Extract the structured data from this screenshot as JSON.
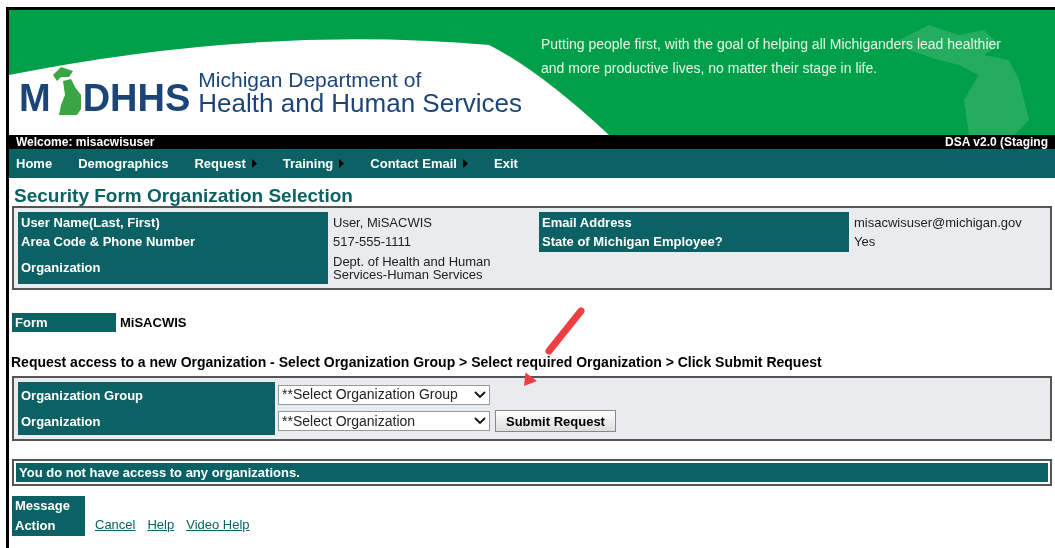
{
  "banner": {
    "logo_left": "M",
    "logo_right": "DHHS",
    "department_line1": "Michigan Department of",
    "department_line2": "Health and Human Services",
    "tagline": "Putting people first, with the goal of helping all Michiganders lead healthier and more productive lives, no matter their stage in life."
  },
  "welcome_bar": {
    "welcome": "Welcome: misacwisuser",
    "version": "DSA v2.0 (Staging"
  },
  "nav": [
    {
      "label": "Home",
      "has_submenu": false
    },
    {
      "label": "Demographics",
      "has_submenu": false
    },
    {
      "label": "Request",
      "has_submenu": true
    },
    {
      "label": "Training",
      "has_submenu": true
    },
    {
      "label": "Contact Email",
      "has_submenu": true
    },
    {
      "label": "Exit",
      "has_submenu": false
    }
  ],
  "page_title": "Security Form Organization Selection",
  "user_info": {
    "left": [
      {
        "label": "User Name(Last, First)",
        "value": "User, MiSACWIS"
      },
      {
        "label": "Area Code & Phone Number",
        "value": "517-555-1111"
      },
      {
        "label": "Organization",
        "value": "Dept. of Health and Human Services-Human Services"
      }
    ],
    "right": [
      {
        "label": "Email Address",
        "value": "misacwisuser@michigan.gov"
      },
      {
        "label": "State of Michigan Employee?",
        "value": "Yes"
      }
    ]
  },
  "form": {
    "label": "Form",
    "value": "MiSACWIS"
  },
  "instruction": "Request access to a new Organization - Select Organization Group > Select required Organization > Click Submit Request",
  "selection": [
    {
      "label": "Organization Group",
      "value": "**Select Organization Group"
    },
    {
      "label": "Organization",
      "value": "**Select Organization"
    }
  ],
  "submit_button": "Submit Request",
  "notice": "You do not have access to any organizations.",
  "message_label": "Message",
  "action_label": "Action",
  "action_links": [
    "Cancel",
    "Help",
    "Video Help"
  ]
}
